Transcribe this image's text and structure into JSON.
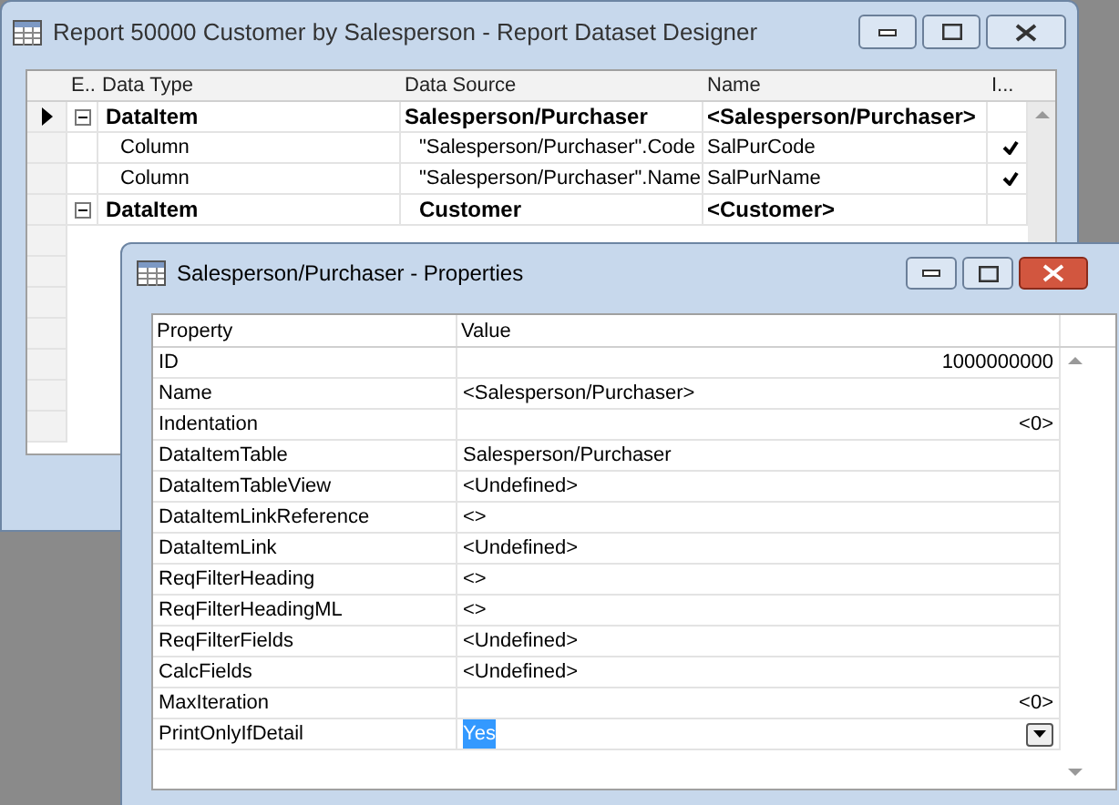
{
  "designer": {
    "title": "Report 50000 Customer by Salesperson - Report Dataset Designer",
    "columns": [
      "E..",
      "Data Type",
      "Data Source",
      "Name",
      "I..."
    ],
    "rows": [
      {
        "kind": "dataitem",
        "selected": true,
        "expanded": true,
        "data_type": "DataItem",
        "data_source": "Salesperson/Purchaser",
        "name": "<Salesperson/Purchaser>",
        "include": false
      },
      {
        "kind": "column",
        "selected": false,
        "data_type": "Column",
        "data_source": "\"Salesperson/Purchaser\".Code",
        "name": "SalPurCode",
        "include": true
      },
      {
        "kind": "column",
        "selected": false,
        "data_type": "Column",
        "data_source": "\"Salesperson/Purchaser\".Name",
        "name": "SalPurName",
        "include": true
      },
      {
        "kind": "dataitem",
        "selected": false,
        "expanded": true,
        "data_type": "DataItem",
        "data_source": "Customer",
        "name": "<Customer>",
        "include": false
      }
    ]
  },
  "properties": {
    "title": "Salesperson/Purchaser - Properties",
    "columns": [
      "Property",
      "Value"
    ],
    "rows": [
      {
        "kind": "number",
        "property": "ID",
        "value": "1000000000"
      },
      {
        "kind": "text",
        "property": "Name",
        "value": "<Salesperson/Purchaser>"
      },
      {
        "kind": "number",
        "property": "Indentation",
        "value": "<0>"
      },
      {
        "kind": "text",
        "property": "DataItemTable",
        "value": "Salesperson/Purchaser"
      },
      {
        "kind": "text",
        "property": "DataItemTableView",
        "value": "<Undefined>"
      },
      {
        "kind": "text",
        "property": "DataItemLinkReference",
        "value": "<>"
      },
      {
        "kind": "text",
        "property": "DataItemLink",
        "value": "<Undefined>"
      },
      {
        "kind": "text",
        "property": "ReqFilterHeading",
        "value": "<>"
      },
      {
        "kind": "text",
        "property": "ReqFilterHeadingML",
        "value": "<>"
      },
      {
        "kind": "text",
        "property": "ReqFilterFields",
        "value": "<Undefined>"
      },
      {
        "kind": "text",
        "property": "CalcFields",
        "value": "<Undefined>"
      },
      {
        "kind": "number",
        "property": "MaxIteration",
        "value": "<0>"
      },
      {
        "kind": "option",
        "property": "PrintOnlyIfDetail",
        "value": "Yes",
        "selected": true
      }
    ]
  }
}
